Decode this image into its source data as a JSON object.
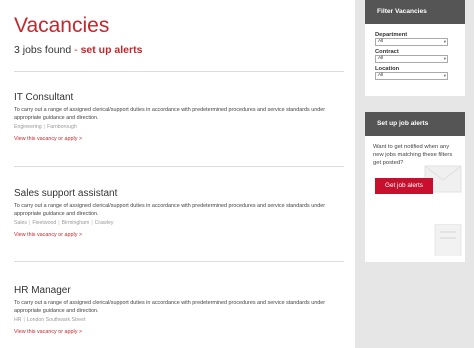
{
  "header": {
    "title": "Vacancies",
    "jobs_count": "3 jobs found",
    "separator": "-",
    "alert_link": "set up alerts"
  },
  "jobs": [
    {
      "title": "IT Consultant",
      "description": "To carry out a range of assigned clerical/support duties in accordance with predetermined procedures and service standards under appropriate guidance and direction.",
      "department": "Engineering",
      "locations": [
        "Farnborough"
      ],
      "link": "View this vacancy or apply >"
    },
    {
      "title": "Sales support assistant",
      "description": "To carry out a range of assigned clerical/support duties in accordance with predetermined procedures and service standards under appropriate guidance and direction.",
      "department": "Sales",
      "locations": [
        "Fleetwood",
        "Birmingham",
        "Crawley"
      ],
      "link": "View this vacancy or apply >"
    },
    {
      "title": "HR Manager",
      "description": "To carry out a range of assigned clerical/support duties in accordance with predetermined procedures and service standards under appropriate guidance and direction.",
      "department": "HR",
      "locations": [
        "London Southwark Street"
      ],
      "link": "View this vacancy or apply >"
    }
  ],
  "filter": {
    "title": "Filter Vacancies",
    "department_label": "Department",
    "department_value": "All",
    "contract_label": "Contract",
    "contract_value": "All",
    "location_label": "Location",
    "location_value": "All"
  },
  "alerts": {
    "title": "Set up job alerts",
    "text": "Want to get notified when any new jobs matching these filters get posted?",
    "button": "Get job alerts",
    "icons": [
      "envelope-icon",
      "document-icon"
    ]
  },
  "colors": {
    "accent": "#c0282d",
    "button": "#c8102e",
    "panel_header": "#555555",
    "sidebar_bg": "#e6e6e6"
  }
}
